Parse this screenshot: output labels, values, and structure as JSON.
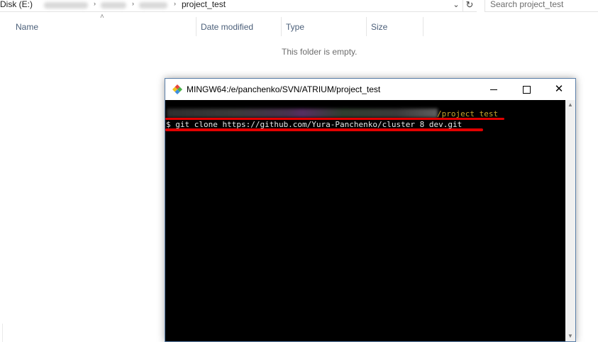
{
  "explorer": {
    "address": {
      "drive_label": "Disk (E:)",
      "current_folder": "project_test"
    },
    "search_placeholder": "Search project_test",
    "columns": [
      "Name",
      "Date modified",
      "Type",
      "Size"
    ],
    "empty_message": "This folder is empty."
  },
  "terminal": {
    "title": "MINGW64:/e/panchenko/SVN/ATRIUM/project_test",
    "prompt_path_tail": "/project_test",
    "command": "$ git clone https://github.com/Yura-Panchenko/cluster_8_dev.git",
    "colors": {
      "background": "#000000",
      "path": "#c7a32c",
      "text": "#e6e6e6",
      "annotation_underline": "#e10000"
    }
  },
  "icons": {
    "dropdown": "chevron-down-icon",
    "refresh": "refresh-icon",
    "app": "git-bash-icon",
    "minimize": "minimize-icon",
    "maximize": "maximize-icon",
    "close": "close-icon"
  }
}
